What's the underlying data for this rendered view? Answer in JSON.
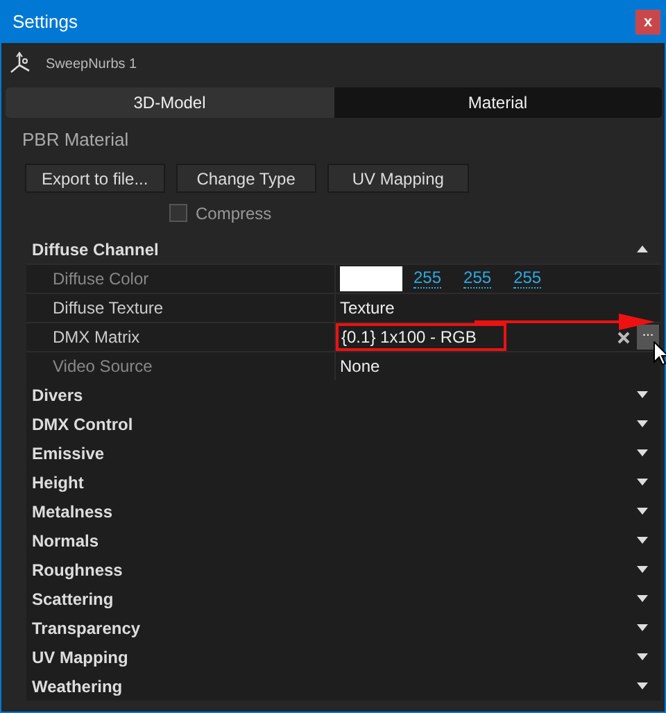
{
  "window": {
    "title": "Settings",
    "close": "x"
  },
  "object": {
    "name": "SweepNurbs 1"
  },
  "tabs": [
    {
      "label": "3D-Model",
      "selected": false
    },
    {
      "label": "Material",
      "selected": true
    }
  ],
  "material": {
    "title": "PBR Material",
    "buttons": [
      "Export to file...",
      "Change Type",
      "UV Mapping"
    ],
    "compress": {
      "label": "Compress",
      "checked": false
    }
  },
  "sections": [
    {
      "title": "Diffuse Channel",
      "expanded": true,
      "properties": [
        {
          "kind": "color",
          "label": "Diffuse Color",
          "disabled": true,
          "values": [
            "255",
            "255",
            "255"
          ]
        },
        {
          "kind": "text",
          "label": "Diffuse Texture",
          "disabled": false,
          "value": "Texture"
        },
        {
          "kind": "matrix",
          "label": "DMX Matrix",
          "disabled": false,
          "value": "{0.1} 1x100 - RGB",
          "browse": "..."
        },
        {
          "kind": "text",
          "label": "Video Source",
          "disabled": true,
          "value": "None"
        }
      ]
    },
    {
      "title": "Divers",
      "expanded": false
    },
    {
      "title": "DMX Control",
      "expanded": false
    },
    {
      "title": "Emissive",
      "expanded": false
    },
    {
      "title": "Height",
      "expanded": false
    },
    {
      "title": "Metalness",
      "expanded": false
    },
    {
      "title": "Normals",
      "expanded": false
    },
    {
      "title": "Roughness",
      "expanded": false
    },
    {
      "title": "Scattering",
      "expanded": false
    },
    {
      "title": "Transparency",
      "expanded": false
    },
    {
      "title": "UV Mapping",
      "expanded": false
    },
    {
      "title": "Weathering",
      "expanded": false
    }
  ]
}
